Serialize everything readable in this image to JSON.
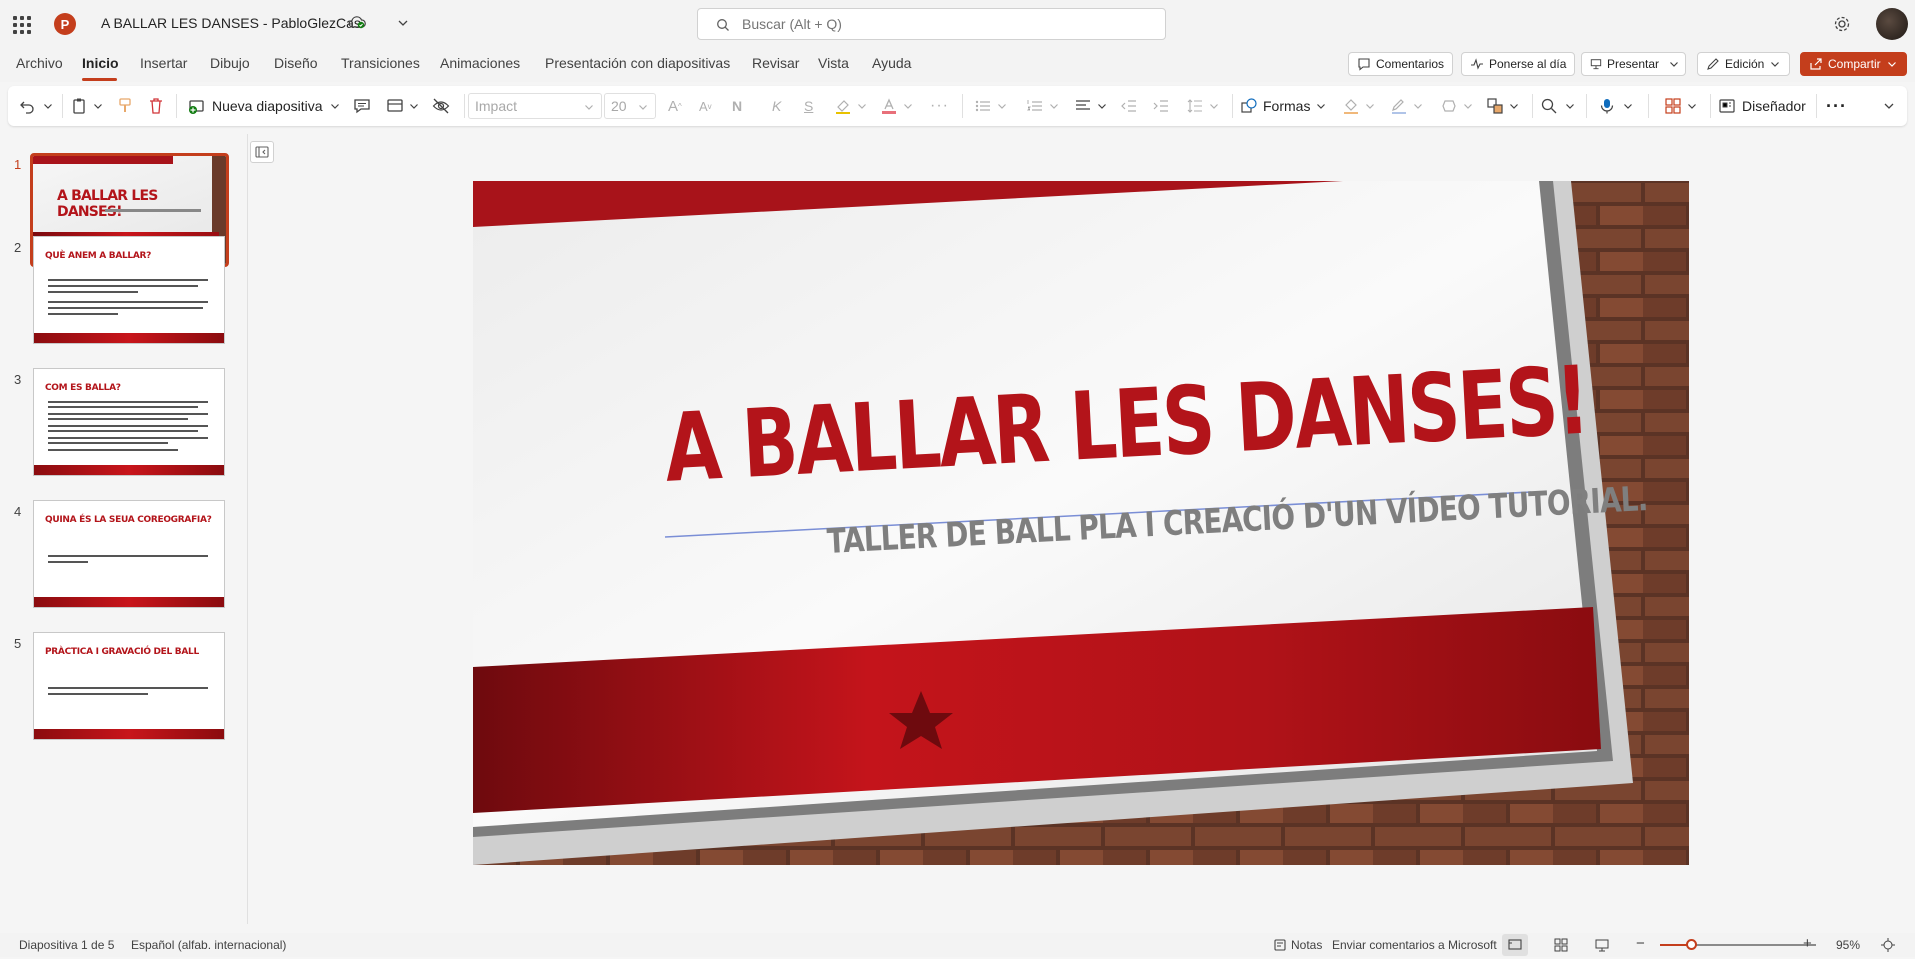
{
  "app": {
    "document_title": "A BALLAR LES DANSES - PabloGlezCas",
    "logo_letter": "P",
    "search_placeholder": "Buscar (Alt + Q)"
  },
  "menu": {
    "items": [
      "Archivo",
      "Inicio",
      "Insertar",
      "Dibujo",
      "Diseño",
      "Transiciones",
      "Animaciones",
      "Presentación con diapositivas",
      "Revisar",
      "Vista",
      "Ayuda"
    ],
    "active": "Inicio",
    "comments_label": "Comentarios",
    "catchup_label": "Ponerse al día",
    "present_label": "Presentar",
    "editing_label": "Edición",
    "share_label": "Compartir"
  },
  "ribbon": {
    "new_slide_label": "Nueva diapositiva",
    "font_name": "Impact",
    "font_size": "20",
    "bold_glyph": "N",
    "italic_glyph": "K",
    "underline_glyph": "S",
    "shapes_label": "Formas",
    "designer_label": "Diseñador",
    "more_label": "···"
  },
  "slides": [
    {
      "number": "1",
      "title": "A BALLAR LES DANSES!",
      "active": true
    },
    {
      "number": "2",
      "title": "QUÈ ANEM A BALLAR?"
    },
    {
      "number": "3",
      "title": "COM ES BALLA?"
    },
    {
      "number": "4",
      "title": "QUINA ÉS LA SEUA COREOGRAFIA?"
    },
    {
      "number": "5",
      "title": "PRÀCTICA I GRAVACIÓ DEL BALL"
    }
  ],
  "current_slide": {
    "title": "A BALLAR LES DANSES!",
    "subtitle": "TALLER DE BALL PLA I CREACIÓ D'UN VÍDEO TUTORIAL."
  },
  "status": {
    "slide_info": "Diapositiva 1 de 5",
    "language": "Español (alfab. internacional)",
    "notes_label": "Notas",
    "feedback_label": "Enviar comentarios a Microsoft",
    "zoom_minus": "−",
    "zoom_plus": "+",
    "zoom_percent": "95%",
    "zoom_level": 0.2
  },
  "colors": {
    "accent": "#c43e1c",
    "slide_red": "#b3141a",
    "subtitle_gray": "#7f7f7f"
  }
}
